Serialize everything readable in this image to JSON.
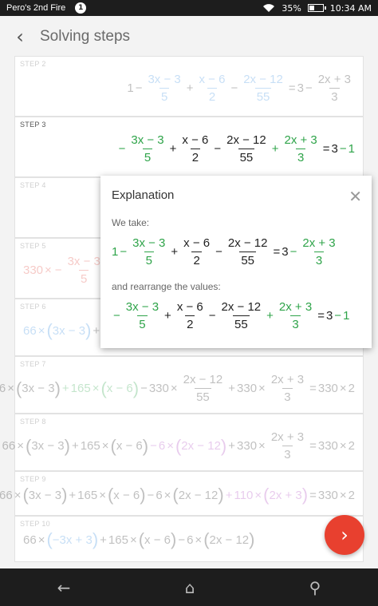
{
  "status": {
    "device": "Pero's 2nd Fire",
    "notifications": "1",
    "battery": "35%",
    "battery_level": 0.35,
    "time": "10:34 AM",
    "wifi_icon": "wifi-icon"
  },
  "header": {
    "back_icon": "‹",
    "title": "Solving steps"
  },
  "steps": [
    {
      "label": "STEP 2"
    },
    {
      "label": "STEP 3"
    },
    {
      "label": "STEP 4"
    },
    {
      "label": "STEP 5"
    },
    {
      "label": "STEP 6"
    },
    {
      "label": "STEP 7"
    },
    {
      "label": "STEP 8"
    },
    {
      "label": "STEP 9"
    },
    {
      "label": "STEP 10"
    }
  ],
  "math": {
    "one": "1",
    "minus": "−",
    "plus": "+",
    "eq": "=",
    "three": "3",
    "times": "×",
    "n1": "3x − 3",
    "n2": "x − 6",
    "n3": "2x − 12",
    "n4": "2x + 3",
    "d5": "5",
    "d2": "2",
    "d55": "55",
    "d3": "3",
    "c66": "66",
    "c165": "165",
    "c330": "330",
    "c6": "6",
    "c110": "110",
    "c2": "2",
    "p1": "3x − 3",
    "p2": "x − 6",
    "p3": "2x − 12",
    "p4": "2x + 3",
    "p1neg": "−3x + 3",
    "lp": "(",
    "rp": ")"
  },
  "popup": {
    "title": "Explanation",
    "close": "✕",
    "line1": "We take:",
    "line2": "and rearrange the values:"
  },
  "fab": {
    "icon": "›"
  },
  "nav": {
    "back": "←",
    "home": "⌂",
    "search": "⚲"
  }
}
